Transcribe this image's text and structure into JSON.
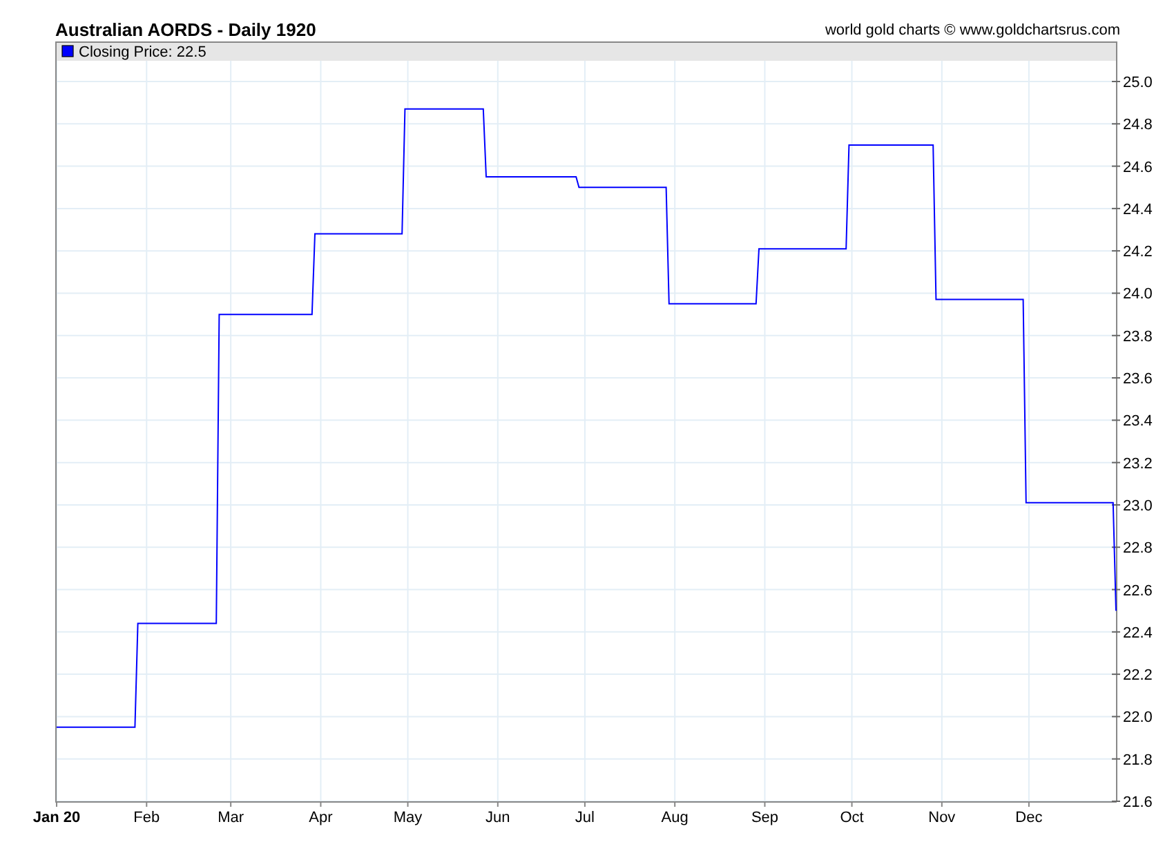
{
  "header": {
    "title": "Australian AORDS - Daily 1920",
    "credit": "world gold charts © www.goldchartsrus.com"
  },
  "chart": {
    "legend_value": ": 22.5",
    "chart_data": {
      "type": "line",
      "grid": true,
      "ylim": [
        21.6,
        25.0
      ],
      "categories": [
        "Jan 20",
        null,
        null,
        null,
        null,
        null,
        null,
        null,
        null,
        null,
        null,
        null,
        null,
        null,
        null,
        null,
        null,
        null,
        null,
        null,
        null,
        null,
        null,
        null,
        null,
        null,
        null,
        null,
        null,
        null,
        null,
        "Feb",
        null,
        null,
        null,
        null,
        null,
        null,
        null,
        null,
        null,
        null,
        null,
        null,
        null,
        null,
        null,
        null,
        null,
        null,
        null,
        null,
        null,
        null,
        null,
        null,
        null,
        null,
        null,
        null,
        "Mar",
        null,
        null,
        null,
        null,
        null,
        null,
        null,
        null,
        null,
        null,
        null,
        null,
        null,
        null,
        null,
        null,
        null,
        null,
        null,
        null,
        null,
        null,
        null,
        null,
        null,
        null,
        null,
        null,
        null,
        null,
        "Apr",
        null,
        null,
        null,
        null,
        null,
        null,
        null,
        null,
        null,
        null,
        null,
        null,
        null,
        null,
        null,
        null,
        null,
        null,
        null,
        null,
        null,
        null,
        null,
        null,
        null,
        null,
        null,
        null,
        null,
        "May",
        null,
        null,
        null,
        null,
        null,
        null,
        null,
        null,
        null,
        null,
        null,
        null,
        null,
        null,
        null,
        null,
        null,
        null,
        null,
        null,
        null,
        null,
        null,
        null,
        null,
        null,
        null,
        null,
        null,
        null,
        "Jun",
        null,
        null,
        null,
        null,
        null,
        null,
        null,
        null,
        null,
        null,
        null,
        null,
        null,
        null,
        null,
        null,
        null,
        null,
        null,
        null,
        null,
        null,
        null,
        null,
        null,
        null,
        null,
        null,
        null,
        "Jul",
        null,
        null,
        null,
        null,
        null,
        null,
        null,
        null,
        null,
        null,
        null,
        null,
        null,
        null,
        null,
        null,
        null,
        null,
        null,
        null,
        null,
        null,
        null,
        null,
        null,
        null,
        null,
        null,
        null,
        null,
        "Aug",
        null,
        null,
        null,
        null,
        null,
        null,
        null,
        null,
        null,
        null,
        null,
        null,
        null,
        null,
        null,
        null,
        null,
        null,
        null,
        null,
        null,
        null,
        null,
        null,
        null,
        null,
        null,
        null,
        null,
        null,
        "Sep",
        null,
        null,
        null,
        null,
        null,
        null,
        null,
        null,
        null,
        null,
        null,
        null,
        null,
        null,
        null,
        null,
        null,
        null,
        null,
        null,
        null,
        null,
        null,
        null,
        null,
        null,
        null,
        null,
        null,
        "Oct",
        null,
        null,
        null,
        null,
        null,
        null,
        null,
        null,
        null,
        null,
        null,
        null,
        null,
        null,
        null,
        null,
        null,
        null,
        null,
        null,
        null,
        null,
        null,
        null,
        null,
        null,
        null,
        null,
        null,
        null,
        "Nov",
        null,
        null,
        null,
        null,
        null,
        null,
        null,
        null,
        null,
        null,
        null,
        null,
        null,
        null,
        null,
        null,
        null,
        null,
        null,
        null,
        null,
        null,
        null,
        null,
        null,
        null,
        null,
        null,
        null,
        "Dec",
        null,
        null,
        null,
        null,
        null,
        null,
        null,
        null,
        null,
        null,
        null,
        null,
        null,
        null,
        null,
        null,
        null,
        null,
        null,
        null,
        null,
        null,
        null,
        null,
        null,
        null,
        null,
        null,
        null,
        null
      ],
      "yticks": [
        {
          "value": 25.0,
          "label": "25.0"
        },
        {
          "value": 24.8,
          "label": "24.8"
        },
        {
          "value": 24.6,
          "label": "24.6"
        },
        {
          "value": 24.4,
          "label": "24.4"
        },
        {
          "value": 24.2,
          "label": "24.2"
        },
        {
          "value": 24.0,
          "label": "24.0"
        },
        {
          "value": 23.8,
          "label": "23.8"
        },
        {
          "value": 23.6,
          "label": "23.6"
        },
        {
          "value": 23.4,
          "label": "23.4"
        },
        {
          "value": 23.2,
          "label": "23.2"
        },
        {
          "value": 23.0,
          "label": "23.0"
        },
        {
          "value": 22.8,
          "label": "22.8"
        },
        {
          "value": 22.6,
          "label": "22.6"
        },
        {
          "value": 22.4,
          "label": "22.4"
        },
        {
          "value": 22.2,
          "label": "22.2"
        },
        {
          "value": 22.0,
          "label": "22.0"
        },
        {
          "value": 21.8,
          "label": "21.8"
        },
        {
          "value": 21.6,
          "label": "21.6"
        }
      ],
      "series": [
        {
          "name": "Closing Price",
          "color": "#0000ff",
          "values": [
            21.95,
            21.95,
            21.95,
            21.95,
            21.95,
            21.95,
            21.95,
            21.95,
            21.95,
            21.95,
            21.95,
            21.95,
            21.95,
            21.95,
            21.95,
            21.95,
            21.95,
            21.95,
            21.95,
            21.95,
            21.95,
            21.95,
            21.95,
            21.95,
            21.95,
            21.95,
            21.95,
            21.95,
            22.44,
            22.44,
            22.44,
            22.44,
            22.44,
            22.44,
            22.44,
            22.44,
            22.44,
            22.44,
            22.44,
            22.44,
            22.44,
            22.44,
            22.44,
            22.44,
            22.44,
            22.44,
            22.44,
            22.44,
            22.44,
            22.44,
            22.44,
            22.44,
            22.44,
            22.44,
            22.44,
            22.44,
            23.9,
            23.9,
            23.9,
            23.9,
            23.9,
            23.9,
            23.9,
            23.9,
            23.9,
            23.9,
            23.9,
            23.9,
            23.9,
            23.9,
            23.9,
            23.9,
            23.9,
            23.9,
            23.9,
            23.9,
            23.9,
            23.9,
            23.9,
            23.9,
            23.9,
            23.9,
            23.9,
            23.9,
            23.9,
            23.9,
            23.9,
            23.9,
            23.9,
            24.28,
            24.28,
            24.28,
            24.28,
            24.28,
            24.28,
            24.28,
            24.28,
            24.28,
            24.28,
            24.28,
            24.28,
            24.28,
            24.28,
            24.28,
            24.28,
            24.28,
            24.28,
            24.28,
            24.28,
            24.28,
            24.28,
            24.28,
            24.28,
            24.28,
            24.28,
            24.28,
            24.28,
            24.28,
            24.28,
            24.28,
            24.87,
            24.87,
            24.87,
            24.87,
            24.87,
            24.87,
            24.87,
            24.87,
            24.87,
            24.87,
            24.87,
            24.87,
            24.87,
            24.87,
            24.87,
            24.87,
            24.87,
            24.87,
            24.87,
            24.87,
            24.87,
            24.87,
            24.87,
            24.87,
            24.87,
            24.87,
            24.87,
            24.87,
            24.55,
            24.55,
            24.55,
            24.55,
            24.55,
            24.55,
            24.55,
            24.55,
            24.55,
            24.55,
            24.55,
            24.55,
            24.55,
            24.55,
            24.55,
            24.55,
            24.55,
            24.55,
            24.55,
            24.55,
            24.55,
            24.55,
            24.55,
            24.55,
            24.55,
            24.55,
            24.55,
            24.55,
            24.55,
            24.55,
            24.55,
            24.55,
            24.5,
            24.5,
            24.5,
            24.5,
            24.5,
            24.5,
            24.5,
            24.5,
            24.5,
            24.5,
            24.5,
            24.5,
            24.5,
            24.5,
            24.5,
            24.5,
            24.5,
            24.5,
            24.5,
            24.5,
            24.5,
            24.5,
            24.5,
            24.5,
            24.5,
            24.5,
            24.5,
            24.5,
            24.5,
            24.5,
            24.5,
            23.95,
            23.95,
            23.95,
            23.95,
            23.95,
            23.95,
            23.95,
            23.95,
            23.95,
            23.95,
            23.95,
            23.95,
            23.95,
            23.95,
            23.95,
            23.95,
            23.95,
            23.95,
            23.95,
            23.95,
            23.95,
            23.95,
            23.95,
            23.95,
            23.95,
            23.95,
            23.95,
            23.95,
            23.95,
            23.95,
            23.95,
            24.21,
            24.21,
            24.21,
            24.21,
            24.21,
            24.21,
            24.21,
            24.21,
            24.21,
            24.21,
            24.21,
            24.21,
            24.21,
            24.21,
            24.21,
            24.21,
            24.21,
            24.21,
            24.21,
            24.21,
            24.21,
            24.21,
            24.21,
            24.21,
            24.21,
            24.21,
            24.21,
            24.21,
            24.21,
            24.21,
            24.21,
            24.7,
            24.7,
            24.7,
            24.7,
            24.7,
            24.7,
            24.7,
            24.7,
            24.7,
            24.7,
            24.7,
            24.7,
            24.7,
            24.7,
            24.7,
            24.7,
            24.7,
            24.7,
            24.7,
            24.7,
            24.7,
            24.7,
            24.7,
            24.7,
            24.7,
            24.7,
            24.7,
            24.7,
            24.7,
            24.7,
            23.97,
            23.97,
            23.97,
            23.97,
            23.97,
            23.97,
            23.97,
            23.97,
            23.97,
            23.97,
            23.97,
            23.97,
            23.97,
            23.97,
            23.97,
            23.97,
            23.97,
            23.97,
            23.97,
            23.97,
            23.97,
            23.97,
            23.97,
            23.97,
            23.97,
            23.97,
            23.97,
            23.97,
            23.97,
            23.97,
            23.97,
            23.01,
            23.01,
            23.01,
            23.01,
            23.01,
            23.01,
            23.01,
            23.01,
            23.01,
            23.01,
            23.01,
            23.01,
            23.01,
            23.01,
            23.01,
            23.01,
            23.01,
            23.01,
            23.01,
            23.01,
            23.01,
            23.01,
            23.01,
            23.01,
            23.01,
            23.01,
            23.01,
            23.01,
            23.01,
            23.01,
            23.01,
            22.5
          ]
        }
      ]
    }
  }
}
